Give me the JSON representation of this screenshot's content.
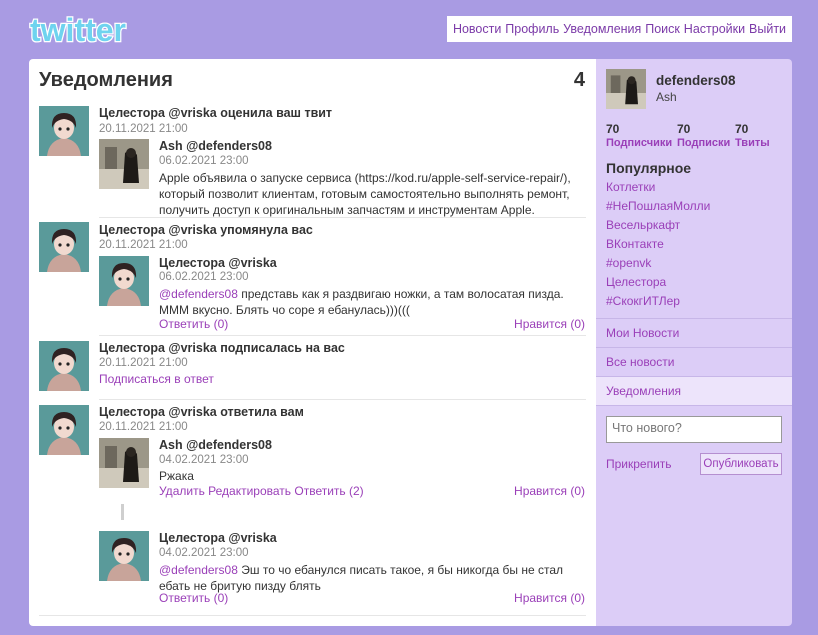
{
  "header": {
    "logo_text": "twitter",
    "nav": [
      "Новости",
      "Профиль",
      "Уведомления",
      "Поиск",
      "Настройки",
      "Выйти"
    ]
  },
  "main": {
    "title": "Уведомления",
    "count": "4",
    "notifications": [
      {
        "headline": "Целестора @vriska оценила ваш твит",
        "date": "20.11.2021 21:00",
        "post": {
          "author": "Ash @defenders08",
          "date": "06.02.2021 23:00",
          "text": "Apple объявила о запуске сервиса (https://kod.ru/apple-self-service-repair/), который позволит клиентам, готовым самостоятельно выполнять ремонт, получить доступ к оригинальным запчастям и инструментам Apple."
        }
      },
      {
        "headline": "Целестора @vriska упомянула вас",
        "date": "20.11.2021 21:00",
        "post": {
          "author": "Целестора @vriska",
          "date": "06.02.2021 23:00",
          "mention": "@defenders08",
          "text": " представь как я раздвигаю ножки, а там волосатая пизда. МММ вкусно. Блять чо соре я ебанулась)))(((",
          "actions": "Ответить (0)",
          "likes": "Нравится (0)"
        }
      },
      {
        "headline": "Целестора @vriska подписалась на вас",
        "date": "20.11.2021 21:00",
        "follow_back": "Подписаться в ответ"
      },
      {
        "headline": "Целестора @vriska ответила вам",
        "date": "20.11.2021 21:00",
        "post": {
          "author": "Ash @defenders08",
          "date": "04.02.2021 23:00",
          "text": "Ржака",
          "actions": "Удалить Редактировать Ответить (2)",
          "likes": "Нравится (0)"
        },
        "reply": {
          "author": "Целестора @vriska",
          "date": "04.02.2021 23:00",
          "mention": "@defenders08",
          "text": " Эш то чо ебанулся писать такое, я бы никогда бы не стал ебать не бритую пизду блять",
          "actions": "Ответить (0)",
          "likes": "Нравится (0)"
        }
      }
    ]
  },
  "sidebar": {
    "username": "defenders08",
    "display_name": "Ash",
    "stats": [
      {
        "num": "70",
        "label": "Подписчики"
      },
      {
        "num": "70",
        "label": "Подписки"
      },
      {
        "num": "70",
        "label": "Твиты"
      }
    ],
    "popular_title": "Популярное",
    "trends": [
      "Котлетки",
      "#НеПошлаяМолли",
      "Весельркафт",
      "ВКонтакте",
      "#openvk",
      "Целестора",
      "#СкокгИТЛер"
    ],
    "menu": [
      "Мои Новости",
      "Все новости",
      "Уведомления"
    ],
    "compose_placeholder": "Что нового?",
    "attach_label": "Прикрепить",
    "publish_label": "Опубликовать"
  },
  "colors": {
    "background": "#a99be3",
    "sidebar": "#dccdf7",
    "link": "#9a3fb8",
    "logo": "#6fd3ef"
  }
}
